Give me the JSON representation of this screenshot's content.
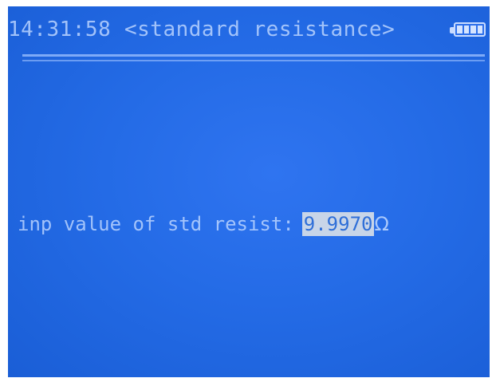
{
  "header": {
    "time": "14:31:58",
    "title": "<standard resistance>",
    "battery_icon": "battery-full-icon",
    "battery_level": 1.0
  },
  "main": {
    "prompt_label": "inp value of std resist:",
    "value": "9.9970",
    "unit": "Ω"
  },
  "colors": {
    "screen_bg": "#246be6",
    "text": "#b9d3ff",
    "highlight_bg": "#c8d5e8"
  }
}
